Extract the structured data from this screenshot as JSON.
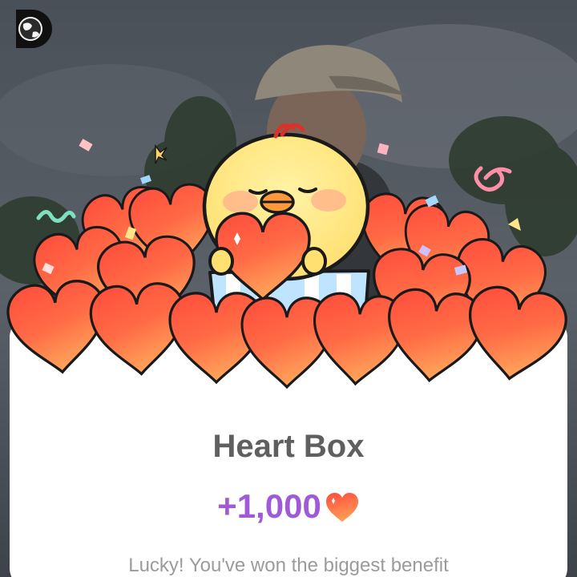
{
  "channel": {
    "logo_icon": "discovery-d-globe-icon"
  },
  "reward_modal": {
    "title": "Heart Box",
    "amount": "+1,000",
    "amount_icon": "heart-icon",
    "message": "Lucky! You've won the biggest benefit",
    "mascot_icon": "yellow-chick-holding-heart-icon",
    "box_icon": "open-gift-box-icon"
  },
  "colors": {
    "amount_purple": "#a05ad8",
    "heart_red": "#f2543e",
    "heart_orange": "#ff9b55",
    "chick_yellow": "#ffe780",
    "title_gray": "#5f5f5f",
    "message_gray": "#9b9b9b"
  }
}
